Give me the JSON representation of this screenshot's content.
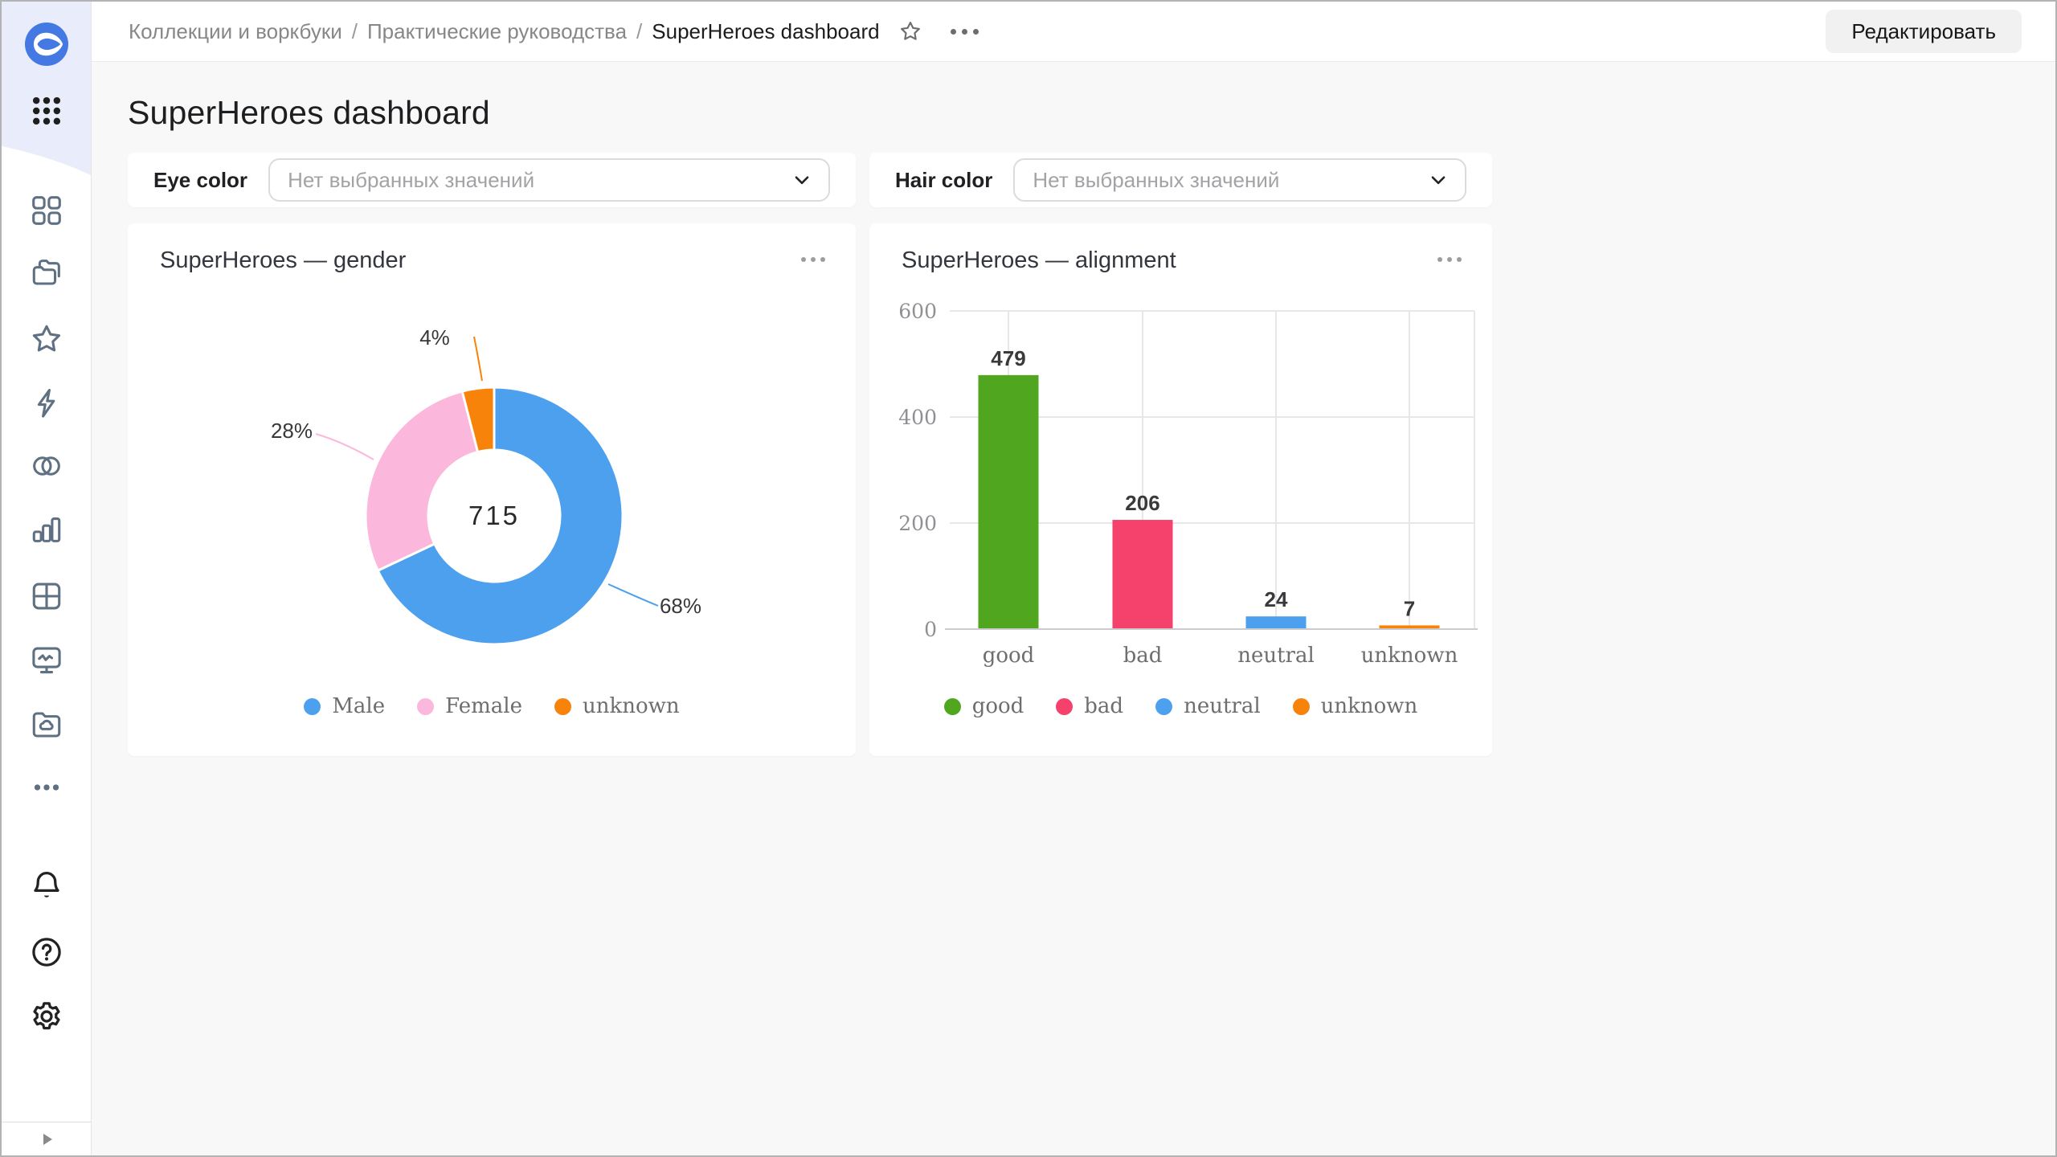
{
  "header": {
    "breadcrumbs": [
      "Коллекции и воркбуки",
      "Практические руководства",
      "SuperHeroes dashboard"
    ],
    "separator": "/",
    "edit_button": "Редактировать"
  },
  "page": {
    "title": "SuperHeroes dashboard"
  },
  "filters": [
    {
      "label": "Eye color",
      "placeholder": "Нет выбранных значений"
    },
    {
      "label": "Hair color",
      "placeholder": "Нет выбранных значений"
    }
  ],
  "sidebar": {
    "icons": [
      "datalens-logo",
      "apps-grid",
      "collections-squares",
      "workbooks-folders",
      "favorites-star",
      "connections-lightning",
      "datasets-circles",
      "charts-bars",
      "dashboards-table",
      "monitoring-screen",
      "storage-folder-cloud",
      "more-dots",
      "notifications-bell",
      "help-question",
      "settings-gear",
      "expand-arrow"
    ]
  },
  "colors": {
    "male_blue": "#4da0ee",
    "female_pink": "#fbb8dc",
    "unknown_orange": "#f8830b",
    "good_green": "#50a61e",
    "bad_rose": "#f5426c",
    "sidebar_accent_bg": "#e9edfb",
    "page_bg": "#f8f8f9"
  },
  "chart_data": [
    {
      "type": "pie",
      "subtype": "donut",
      "title": "SuperHeroes — gender",
      "center_total": "715",
      "legend_position": "bottom",
      "slices": [
        {
          "label": "Male",
          "pct": 68,
          "color": "#4da0ee"
        },
        {
          "label": "Female",
          "pct": 28,
          "color": "#fbb8dc"
        },
        {
          "label": "unknown",
          "pct": 4,
          "color": "#f8830b"
        }
      ]
    },
    {
      "type": "bar",
      "title": "SuperHeroes — alignment",
      "categories": [
        "good",
        "bad",
        "neutral",
        "unknown"
      ],
      "values": [
        479,
        206,
        24,
        7
      ],
      "colors": [
        "#50a61e",
        "#f5426c",
        "#4da0ee",
        "#f8830b"
      ],
      "ylim": [
        0,
        600
      ],
      "yticks": [
        0,
        200,
        400,
        600
      ],
      "grid": true,
      "legend_position": "bottom"
    }
  ]
}
